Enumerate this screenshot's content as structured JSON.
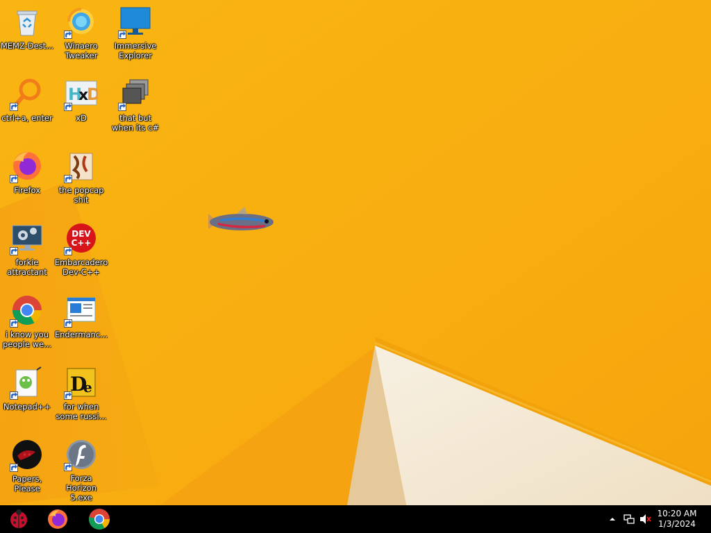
{
  "desktop_icons": [
    {
      "label": "MEMZ-Dest...",
      "icon": "recycle-bin-icon"
    },
    {
      "label": "Winaero Tweaker",
      "icon": "winaero-tweaker-icon"
    },
    {
      "label": "Immersive Explorer",
      "icon": "monitor-icon"
    },
    {
      "label": "ctrl+a, enter",
      "icon": "magnifier-icon"
    },
    {
      "label": "xD",
      "icon": "hxd-icon"
    },
    {
      "label": "that but when its c#",
      "icon": "stacked-windows-icon"
    },
    {
      "label": "Firefox",
      "icon": "firefox-icon"
    },
    {
      "label": "the popcap shit",
      "icon": "popcap-icon"
    },
    {
      "label": "forkie attractant",
      "icon": "settings-monitor-icon"
    },
    {
      "label": "Embarcadero Dev-C++",
      "icon": "devcpp-icon"
    },
    {
      "label": "i know you people we...",
      "icon": "chrome-icon"
    },
    {
      "label": "Endermanc...",
      "icon": "window-app-icon"
    },
    {
      "label": "Notepad++",
      "icon": "notepadpp-icon"
    },
    {
      "label": "for when some russi...",
      "icon": "de-icon"
    },
    {
      "label": "Papers, Please",
      "icon": "papers-please-icon"
    },
    {
      "label": "Forza Horizon 5.exe",
      "icon": "flash-icon"
    }
  ],
  "taskbar": {
    "pinned": [
      {
        "name": "start-button",
        "icon": "ladybug-icon"
      },
      {
        "name": "firefox",
        "icon": "firefox-icon"
      },
      {
        "name": "chrome",
        "icon": "chrome-icon"
      }
    ],
    "tray": {
      "show_hidden_icon": "chevron-up-icon",
      "network_icon": "network-icon",
      "volume_icon": "volume-muted-icon"
    },
    "clock": {
      "time": "10:20 AM",
      "date": "1/3/2024"
    }
  },
  "colors": {
    "wallpaper_orange": "#f7ad10",
    "wallpaper_light": "#f4ead8",
    "taskbar": "#000000"
  }
}
